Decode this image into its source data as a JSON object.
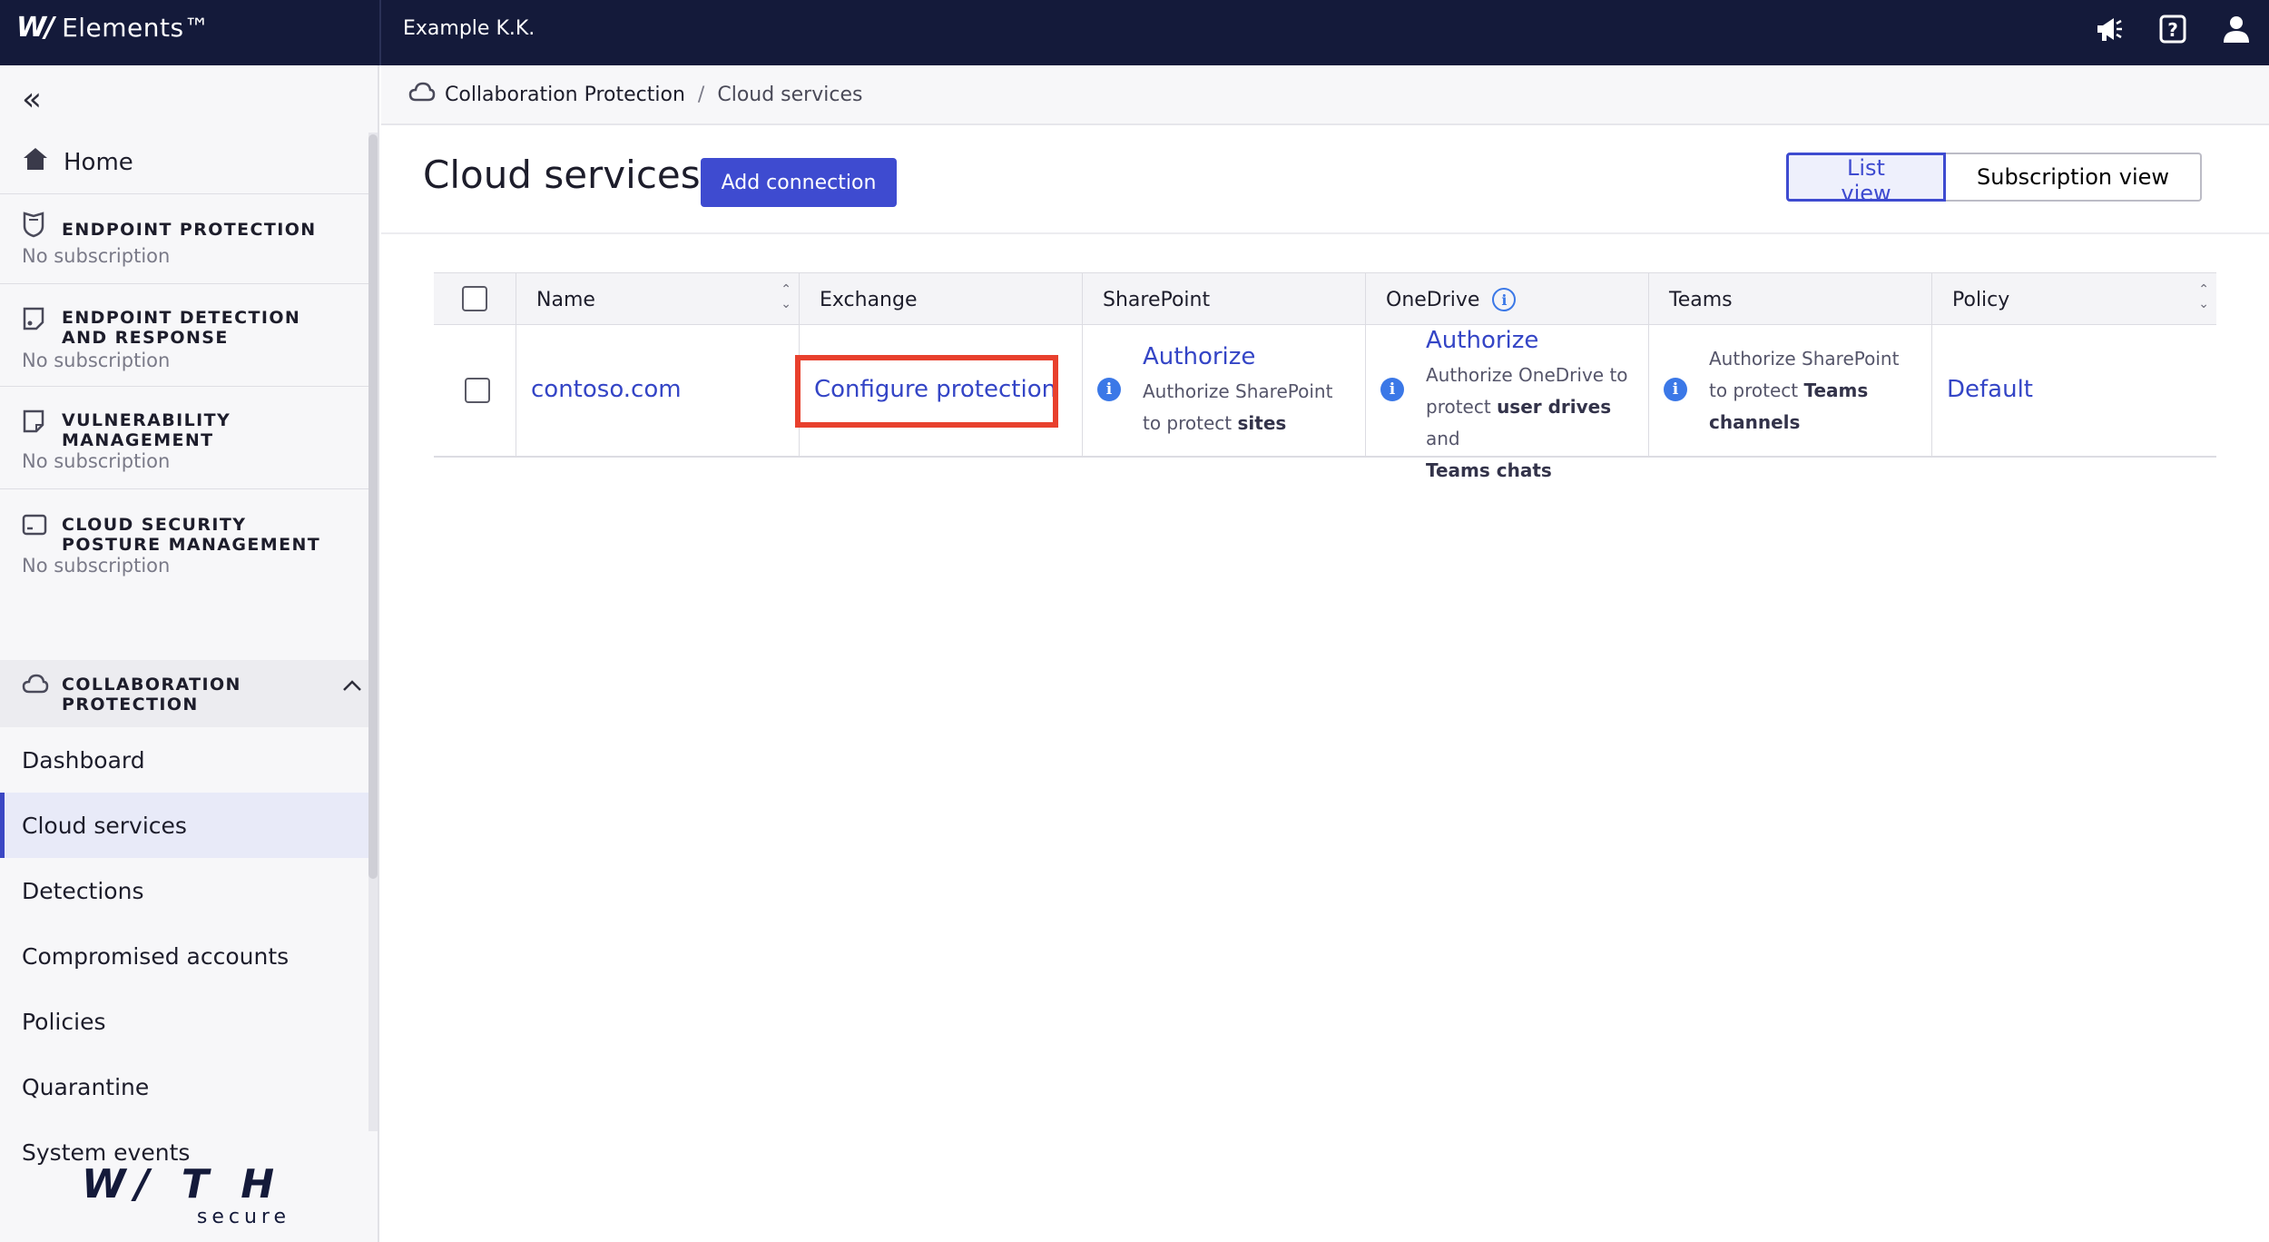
{
  "topbar": {
    "brand_mark": "W/",
    "brand_name": "Elements™",
    "org_name": "Example K.K."
  },
  "icons": {
    "announce": "megaphone-icon",
    "help": "help-icon",
    "user": "user-icon"
  },
  "sidebar": {
    "home_label": "Home",
    "products": [
      {
        "title_line1": "ENDPOINT PROTECTION",
        "title_line2": "",
        "status": "No subscription"
      },
      {
        "title_line1": "ENDPOINT DETECTION",
        "title_line2": "AND RESPONSE",
        "status": "No subscription"
      },
      {
        "title_line1": "VULNERABILITY",
        "title_line2": "MANAGEMENT",
        "status": "No subscription"
      },
      {
        "title_line1": "CLOUD SECURITY",
        "title_line2": "POSTURE MANAGEMENT",
        "status": "No subscription"
      }
    ],
    "collab": {
      "title_line1": "COLLABORATION",
      "title_line2": "PROTECTION"
    },
    "sub_items": [
      "Dashboard",
      "Cloud services",
      "Detections",
      "Compromised accounts",
      "Policies",
      "Quarantine",
      "System events"
    ],
    "active_item": "Cloud services",
    "footer_logo_main": "W/ T H",
    "footer_logo_sub": "secure"
  },
  "breadcrumb": {
    "parent": "Collaboration Protection",
    "current": "Cloud services"
  },
  "header": {
    "title": "Cloud services",
    "add_button": "Add connection",
    "list_view": "List view",
    "subscription_view": "Subscription view"
  },
  "table": {
    "columns": [
      "Name",
      "Exchange",
      "SharePoint",
      "OneDrive",
      "Teams",
      "Policy"
    ],
    "row": {
      "name": "contoso.com",
      "exchange": "Configure protection",
      "sharepoint_link": "Authorize",
      "sharepoint_text_1": "Authorize SharePoint",
      "sharepoint_text_2a": "to protect ",
      "sharepoint_text_2b": "sites",
      "onedrive_link": "Authorize",
      "onedrive_text_1": "Authorize OneDrive to",
      "onedrive_text_2a": "protect ",
      "onedrive_text_2b": "user drives",
      "onedrive_text_2c": " and",
      "onedrive_text_3": "Teams chats",
      "teams_text_1": "Authorize SharePoint",
      "teams_text_2a": "to protect ",
      "teams_text_2b": "Teams",
      "teams_text_3": "channels",
      "policy": "Default"
    }
  },
  "colors": {
    "topbar": "#141a3a",
    "accent": "#3e4bd0",
    "link": "#3445c6",
    "highlight": "#e8402d",
    "info": "#3b78e7"
  }
}
